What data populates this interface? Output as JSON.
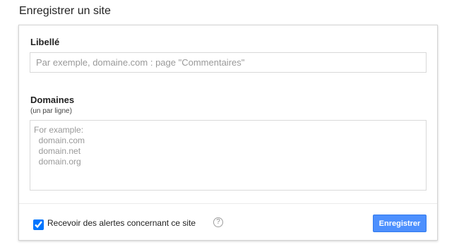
{
  "page": {
    "title": "Enregistrer un site"
  },
  "form": {
    "label_field": {
      "label": "Libellé",
      "placeholder": "Par exemple, domaine.com : page \"Commentaires\"",
      "value": ""
    },
    "domains_field": {
      "label": "Domaines",
      "hint": "(un par ligne)",
      "placeholder": "For example:\n  domain.com\n  domain.net\n  domain.org",
      "value": ""
    },
    "alerts": {
      "label": "Recevoir des alertes concernant ce site",
      "checked": true,
      "help_icon": "question-mark-circle-icon",
      "help_glyph": "?"
    },
    "save_label": "Enregistrer"
  },
  "colors": {
    "accent": "#4d90fe",
    "accent_border": "#3079ed"
  }
}
